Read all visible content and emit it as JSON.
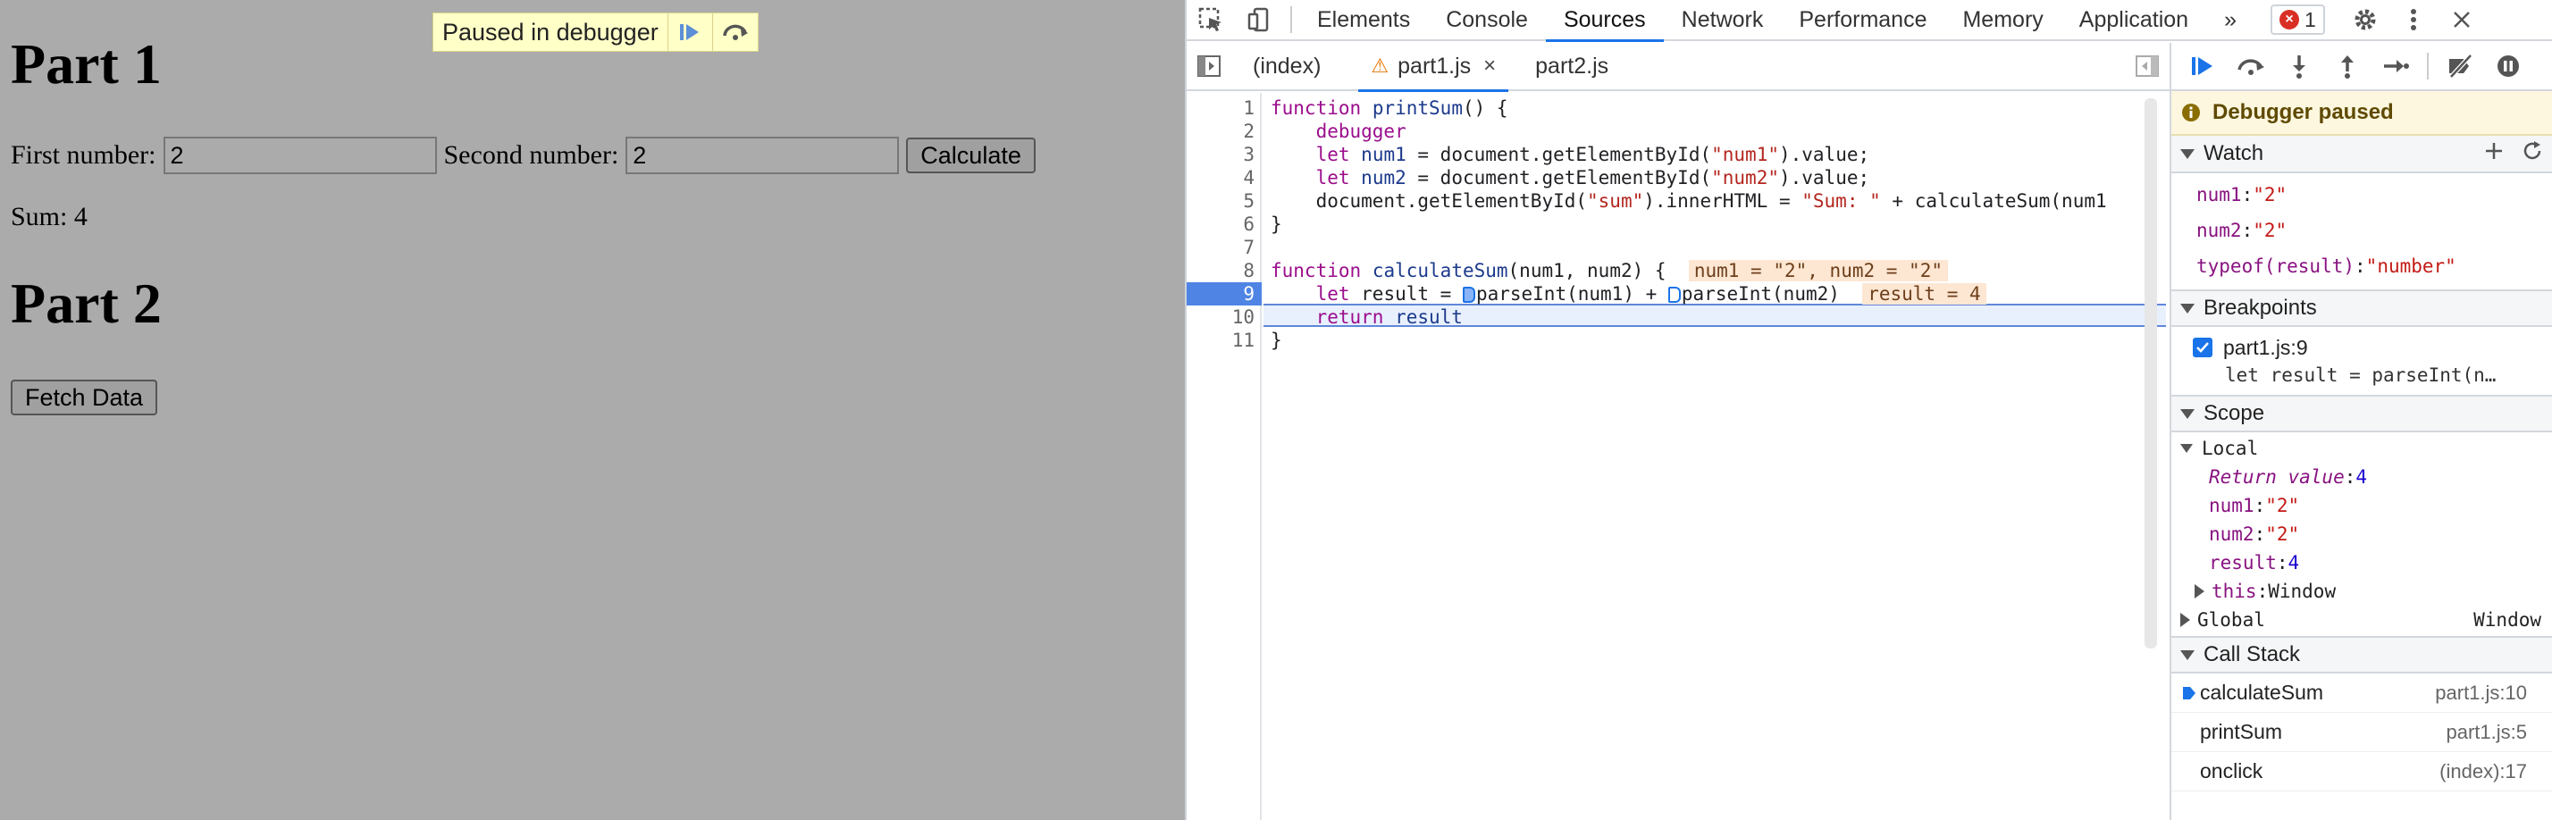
{
  "page": {
    "part1_heading": "Part 1",
    "first_label": "First number:",
    "first_value": "2",
    "second_label": "Second number:",
    "second_value": "2",
    "calculate_label": "Calculate",
    "sum_text": "Sum: 4",
    "part2_heading": "Part 2",
    "fetch_label": "Fetch Data"
  },
  "paused_overlay": {
    "label": "Paused in debugger"
  },
  "devtools": {
    "tabs": [
      "Elements",
      "Console",
      "Sources",
      "Network",
      "Performance",
      "Memory",
      "Application"
    ],
    "active_tab": "Sources",
    "more_tabs": "»",
    "error_count": "1",
    "error_glyph": "×",
    "file_tabs": {
      "index": "(index)",
      "part1": "part1.js",
      "part2": "part2.js",
      "close": "×",
      "warn": "⚠"
    },
    "line_numbers": [
      "1",
      "2",
      "3",
      "4",
      "5",
      "6",
      "7",
      "8",
      "9",
      "10",
      "11"
    ],
    "code": {
      "l1_kw": "function",
      "l1_fn": "printSum",
      "l1_rest": "() {",
      "l2_kw": "debugger",
      "l3_kw": "let",
      "l3_var": "num1",
      "l3_eq": " = document.getElementById(",
      "l3_str": "\"num1\"",
      "l3_end": ").value;",
      "l4_kw": "let",
      "l4_var": "num2",
      "l4_eq": " = document.getElementById(",
      "l4_str": "\"num2\"",
      "l4_end": ").value;",
      "l5": "document.getElementById(",
      "l5_str": "\"sum\"",
      "l5_mid": ").innerHTML = ",
      "l5_str2": "\"Sum: \"",
      "l5_end": " + calculateSum(num1",
      "l6": "}",
      "l8_kw": "function",
      "l8_fn": "calculateSum",
      "l8_rest": "(num1, num2) {",
      "l8_hint": "num1 = \"2\", num2 = \"2\"",
      "l9_kw": "let",
      "l9_a": " result = ",
      "l9_b": "parseInt(num1) + ",
      "l9_c": "parseInt(num2)",
      "l9_hint": "result = 4",
      "l10_kw": "return",
      "l10_var": "result",
      "l11": "}"
    },
    "debugger": {
      "paused_text": "Debugger paused",
      "watch_title": "Watch",
      "watch": [
        {
          "name": "num1",
          "value": "\"2\""
        },
        {
          "name": "num2",
          "value": "\"2\""
        },
        {
          "name": "typeof(result)",
          "value": "\"number\""
        }
      ],
      "breakpoints_title": "Breakpoints",
      "breakpoint_file": "part1.js:9",
      "breakpoint_code": "let result = parseInt(n…",
      "scope_title": "Scope",
      "local_label": "Local",
      "return_label": "Return value",
      "return_value": "4",
      "scope_vars": [
        {
          "name": "num1",
          "value": "\"2\""
        },
        {
          "name": "num2",
          "value": "\"2\""
        },
        {
          "name": "result",
          "value": "4"
        }
      ],
      "this_label": "this",
      "this_value": "Window",
      "global_label": "Global",
      "global_value": "Window",
      "callstack_title": "Call Stack",
      "callstack": [
        {
          "fn": "calculateSum",
          "loc": "part1.js:10"
        },
        {
          "fn": "printSum",
          "loc": "part1.js:5"
        },
        {
          "fn": "onclick",
          "loc": "(index):17"
        }
      ]
    }
  }
}
